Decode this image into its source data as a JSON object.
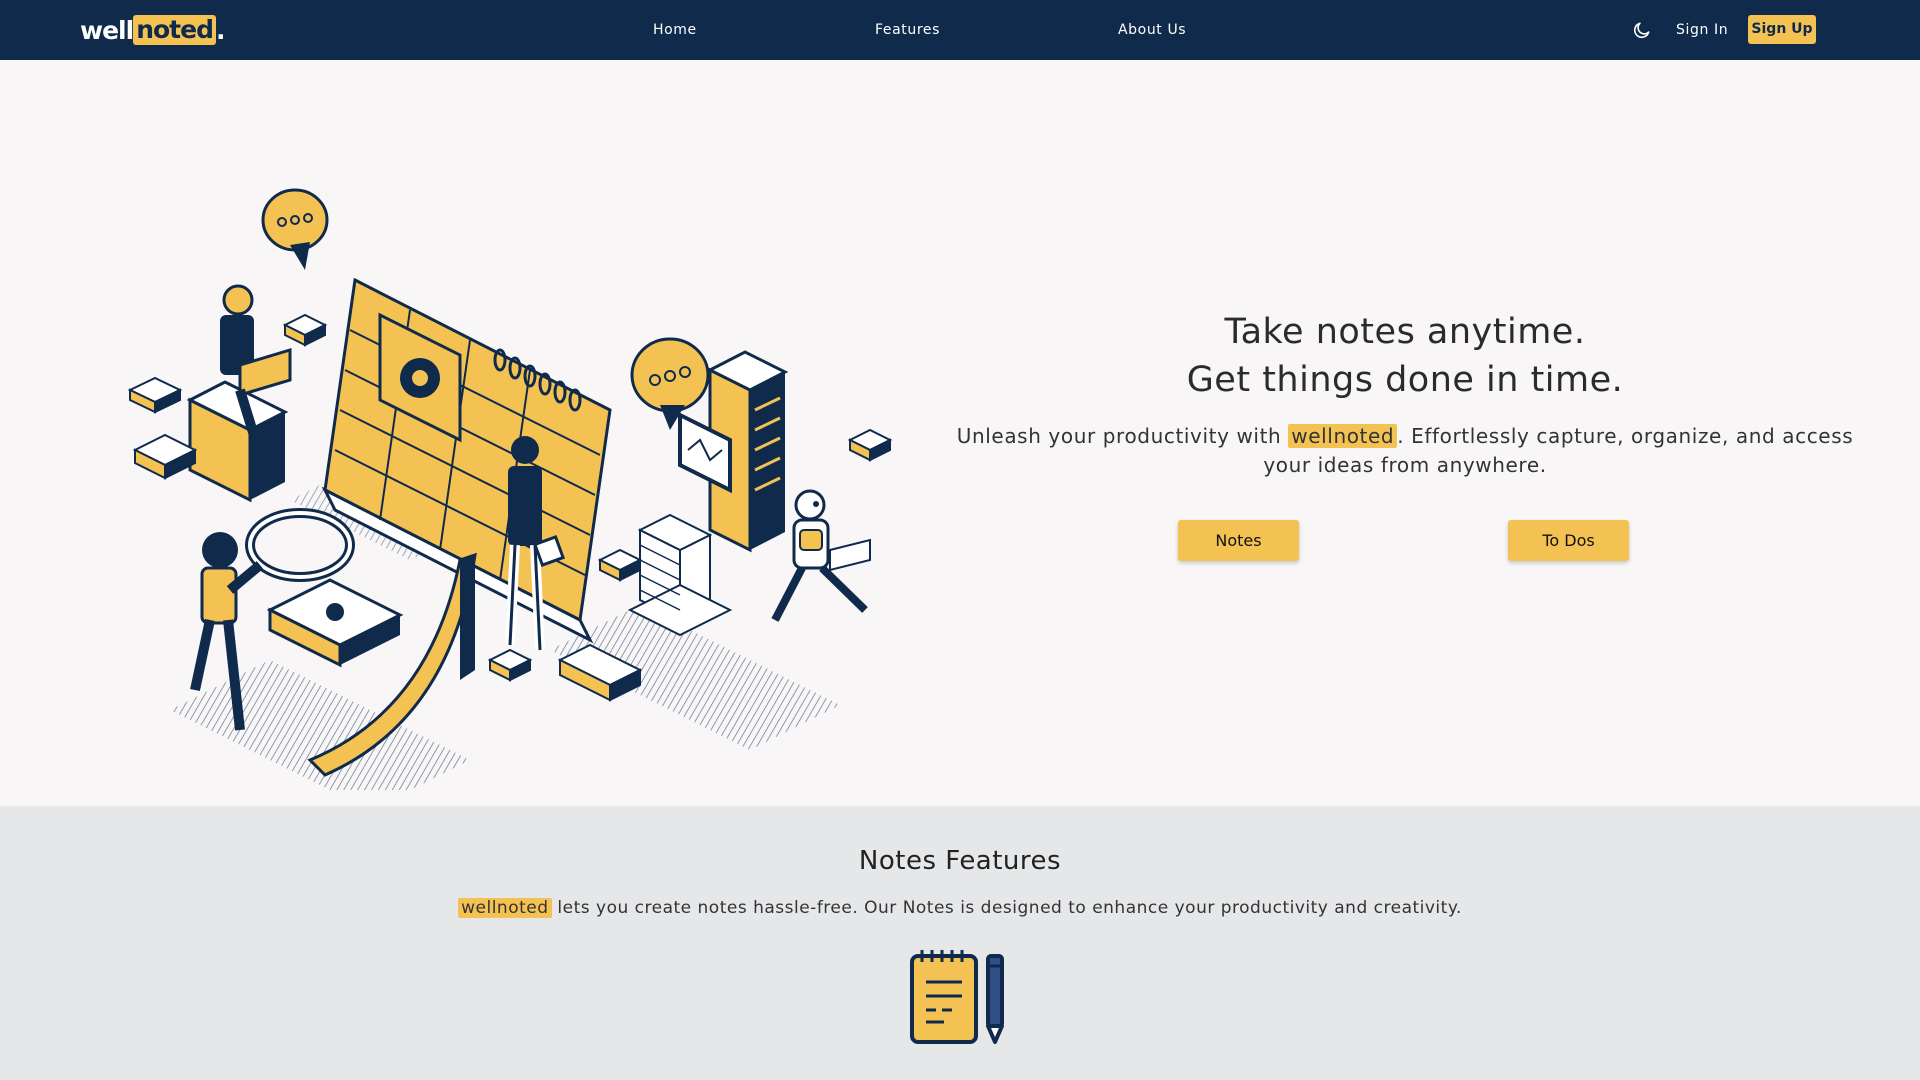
{
  "colors": {
    "navy": "#102a4c",
    "accent": "#f4c253",
    "hero_bg": "#f8f6f7",
    "features_bg": "#e6e7e9"
  },
  "nav": {
    "logo": {
      "part1": "well",
      "part2": "noted",
      "part3": "."
    },
    "links": [
      "Home",
      "Features",
      "About Us"
    ],
    "theme_toggle_icon": "moon-icon",
    "sign_in": "Sign In",
    "sign_up": "Sign Up"
  },
  "hero": {
    "illustration": "isometric-productivity-illustration",
    "title_line1": "Take notes anytime.",
    "title_line2": "Get things done in time.",
    "desc_prefix": "Unleash your productivity with ",
    "desc_brand": "wellnoted",
    "desc_suffix": ". Effortlessly capture, organize, and access your ideas from anywhere.",
    "buttons": [
      "Notes",
      "To Dos"
    ]
  },
  "features": {
    "title": "Notes Features",
    "desc_brand": "wellnoted",
    "desc_suffix": " lets you create notes hassle-free. Our Notes is designed to enhance your productivity and creativity.",
    "icon": "notepad-pencil-icon"
  }
}
